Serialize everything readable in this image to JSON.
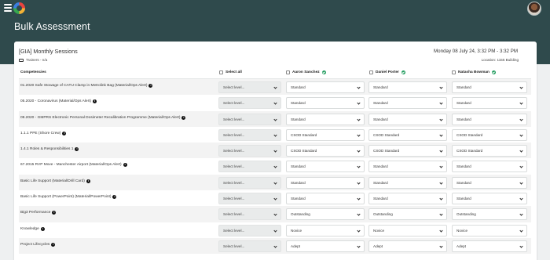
{
  "header": {
    "title": "Bulk Assessment"
  },
  "session": {
    "title": "[GIA] Monthly Sessions",
    "trainers": "Trainers - n/a",
    "datetime": "Monday 08 July 24, 3:32 PM - 3:32 PM",
    "location": "Location: 1155 Building"
  },
  "table": {
    "competencies_header": "Competencies",
    "select_all_label": "Select all",
    "learners": [
      "Aaron Sanchez",
      "Daniel Porter",
      "Natasha Bowman"
    ],
    "level_placeholder": "Select level...",
    "rows": [
      {
        "name": "01.2020 Safe Stowage of CATU Clamp in Metrolink Bag (Material/Ops Alert)",
        "info": true,
        "values": [
          "Standard",
          "Standard",
          "Standard"
        ]
      },
      {
        "name": "05.2020 - Coronavirus (Material/Ops Alert)",
        "info": true,
        "values": [
          "Standard",
          "Standard",
          "Standard"
        ]
      },
      {
        "name": "09.2020 - GMPRS Electronic Personal Dosimeter Recalibration Programme (Material/Ops Alert)",
        "info": true,
        "values": [
          "Standard",
          "Standard",
          "Standard"
        ]
      },
      {
        "name": "1.1.1 PPE (Shore Crew)",
        "info": true,
        "values": [
          "CSOD Standard",
          "CSOD Standard",
          "CSOD Standard"
        ]
      },
      {
        "name": "1.4.1 Roles & Responsibilities 1",
        "info": true,
        "values": [
          "CSOD Standard",
          "CSOD Standard",
          "CSOD Standard"
        ]
      },
      {
        "name": "67.2015 RVP Move - Manchester Airport (Material/Ops Alert)",
        "info": true,
        "values": [
          "Standard",
          "Standard",
          "Standard"
        ]
      },
      {
        "name": "Basic Life Support (Material/Drill Card)",
        "info": true,
        "values": [
          "Standard",
          "Standard",
          "Standard"
        ]
      },
      {
        "name": "Basic Life Support (PowerPoint) (Material/PowerPoint)",
        "info": true,
        "values": [
          "Standard",
          "Standard",
          "Standard"
        ]
      },
      {
        "name": "Big3 Performance",
        "info": true,
        "values": [
          "Outstanding",
          "Outstanding",
          "Outstanding"
        ]
      },
      {
        "name": "Knowledge",
        "info": true,
        "values": [
          "Novice",
          "Novice",
          "Novice"
        ]
      },
      {
        "name": "Project Lifecycles",
        "info": true,
        "values": [
          "Adept",
          "Adept",
          "Adept"
        ]
      }
    ]
  },
  "colors": {
    "header_bg": "#2f4a4c",
    "check_green": "#1d9a5b",
    "row_alt": "#f3f3f3"
  },
  "icons": {
    "menu": "hamburger-icon",
    "logo": "app-logo",
    "trainers": "trainer-icon",
    "info": "info-icon",
    "check": "check-circle-icon",
    "dropdown": "chevron-down-icon"
  }
}
